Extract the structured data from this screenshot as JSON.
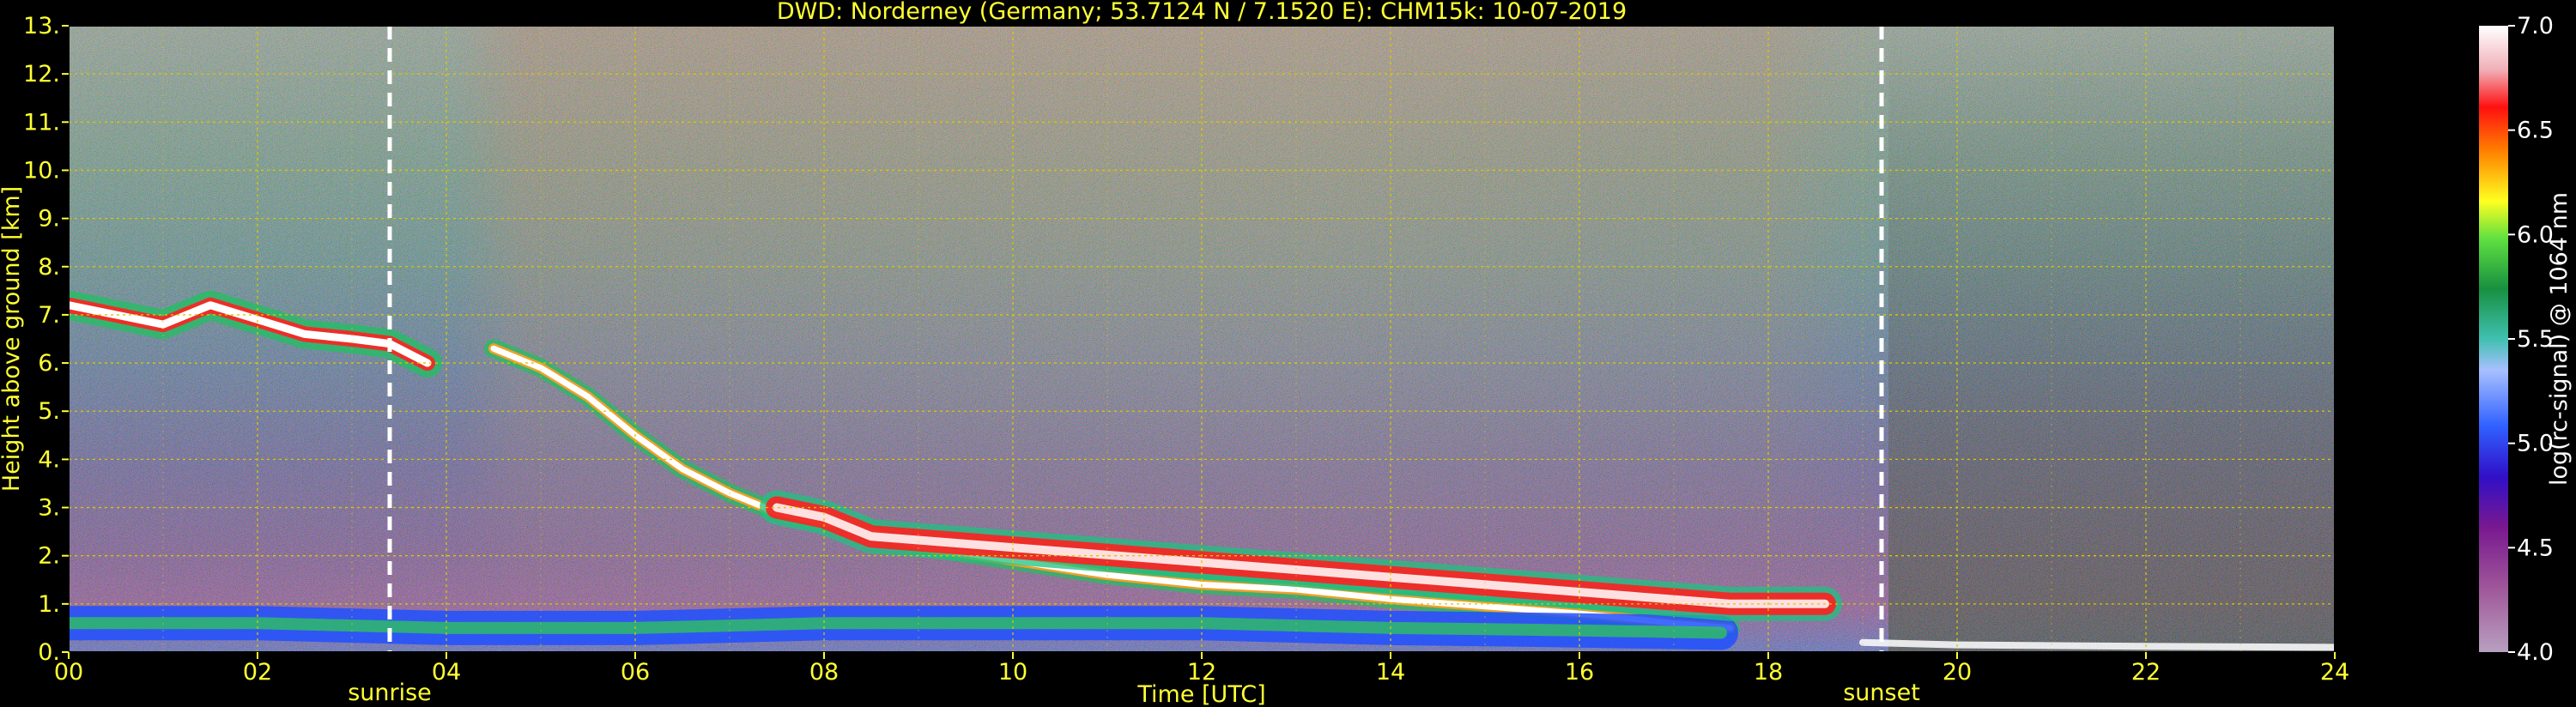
{
  "chart_data": {
    "type": "heatmap",
    "title": "DWD: Norderney (Germany; 53.7124 N / 7.1520 E):    CHM15k: 10-07-2019",
    "xlabel": "Time [UTC]",
    "ylabel": "Height above ground [km]",
    "colorbar_label": "log(rc-signal) @ 1064 nm",
    "xlim": [
      0,
      24
    ],
    "ylim": [
      0,
      13
    ],
    "x_ticks": [
      "00",
      "02",
      "04",
      "06",
      "08",
      "10",
      "12",
      "14",
      "16",
      "18",
      "20",
      "22",
      "24"
    ],
    "y_ticks": [
      "0.",
      "1.",
      "2.",
      "3.",
      "4.",
      "5.",
      "6.",
      "7.",
      "8.",
      "9.",
      "10.",
      "11.",
      "12.",
      "13."
    ],
    "colorbar_range": [
      4.0,
      7.0
    ],
    "colorbar_ticks": [
      "4.0",
      "4.5",
      "5.0",
      "5.5",
      "6.0",
      "6.5",
      "7.0"
    ],
    "grid": true,
    "annotations": [
      {
        "label": "sunrise",
        "x": 3.4
      },
      {
        "label": "sunset",
        "x": 19.2
      }
    ],
    "layers": [
      {
        "name": "cirrus",
        "points": [
          [
            0,
            7.2
          ],
          [
            0.5,
            7.0
          ],
          [
            1,
            6.8
          ],
          [
            1.5,
            7.2
          ],
          [
            2,
            6.9
          ],
          [
            2.5,
            6.6
          ],
          [
            3,
            6.5
          ],
          [
            3.4,
            6.4
          ],
          [
            3.8,
            6.0
          ]
        ]
      },
      {
        "name": "descending-cloud",
        "points": [
          [
            4.5,
            6.3
          ],
          [
            5,
            5.9
          ],
          [
            5.5,
            5.3
          ],
          [
            6,
            4.5
          ],
          [
            6.5,
            3.8
          ],
          [
            7,
            3.3
          ],
          [
            7.5,
            2.9
          ],
          [
            8,
            2.7
          ],
          [
            8.5,
            2.5
          ],
          [
            9,
            2.2
          ],
          [
            10,
            1.9
          ],
          [
            11,
            1.6
          ],
          [
            12,
            1.4
          ],
          [
            13,
            1.3
          ],
          [
            14,
            1.1
          ],
          [
            15,
            0.95
          ],
          [
            16,
            0.8
          ],
          [
            17,
            0.6
          ],
          [
            17.6,
            0.5
          ]
        ]
      },
      {
        "name": "boundary-layer",
        "points": [
          [
            0,
            0.6
          ],
          [
            2,
            0.6
          ],
          [
            4,
            0.5
          ],
          [
            6,
            0.5
          ],
          [
            8,
            0.6
          ],
          [
            10,
            0.6
          ],
          [
            12,
            0.6
          ],
          [
            14,
            0.5
          ],
          [
            16,
            0.45
          ],
          [
            17.5,
            0.4
          ]
        ]
      },
      {
        "name": "convective-cells",
        "points": [
          [
            7.5,
            3.0
          ],
          [
            8,
            2.8
          ],
          [
            8.5,
            2.4
          ],
          [
            17.6,
            1.0
          ],
          [
            18.6,
            1.0
          ]
        ]
      },
      {
        "name": "night-layer",
        "points": [
          [
            19,
            0.2
          ],
          [
            20,
            0.15
          ],
          [
            22,
            0.12
          ],
          [
            24,
            0.1
          ]
        ]
      }
    ]
  }
}
